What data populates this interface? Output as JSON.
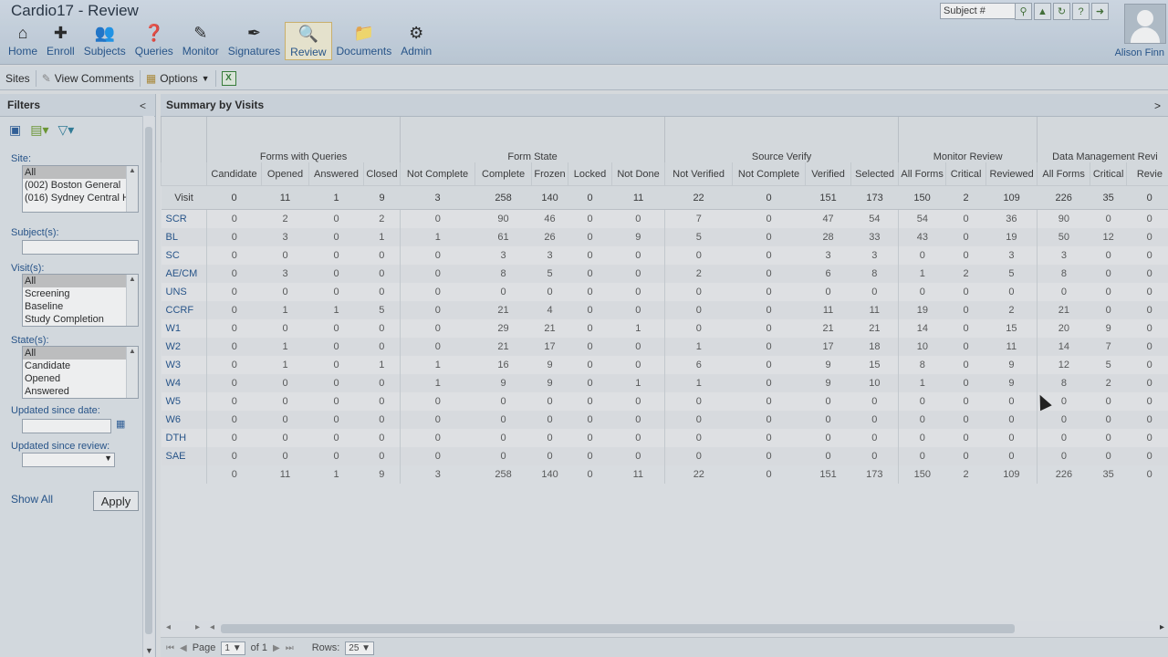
{
  "app": {
    "title": "Cardio17 - Review",
    "user": "Alison Finn"
  },
  "nav": [
    {
      "label": "Home",
      "icon": "home-icon",
      "glyph": "⌂",
      "active": false
    },
    {
      "label": "Enroll",
      "icon": "enroll-icon",
      "glyph": "✚",
      "active": false
    },
    {
      "label": "Subjects",
      "icon": "subjects-icon",
      "glyph": "👥",
      "active": false
    },
    {
      "label": "Queries",
      "icon": "queries-icon",
      "glyph": "❓",
      "active": false
    },
    {
      "label": "Monitor",
      "icon": "monitor-icon",
      "glyph": "✎",
      "active": false
    },
    {
      "label": "Signatures",
      "icon": "signatures-icon",
      "glyph": "✒",
      "active": false
    },
    {
      "label": "Review",
      "icon": "review-icon",
      "glyph": "🔍",
      "active": true
    },
    {
      "label": "Documents",
      "icon": "documents-icon",
      "glyph": "📁",
      "active": false
    },
    {
      "label": "Admin",
      "icon": "admin-icon",
      "glyph": "⚙",
      "active": false
    }
  ],
  "header": {
    "subject_placeholder": "Subject #"
  },
  "toolbar": {
    "sites": "Sites",
    "view_comments": "View Comments",
    "options": "Options"
  },
  "filters": {
    "title": "Filters",
    "site_label": "Site:",
    "sites": [
      "All",
      "(002) Boston General",
      "(016) Sydney Central H"
    ],
    "subject_label": "Subject(s):",
    "visit_label": "Visit(s):",
    "visits": [
      "All",
      "Screening",
      "Baseline",
      "Study Completion"
    ],
    "state_label": "State(s):",
    "states": [
      "All",
      "Candidate",
      "Opened",
      "Answered"
    ],
    "updated_date_label": "Updated since date:",
    "updated_review_label": "Updated since review:",
    "show_all": "Show All",
    "apply": "Apply"
  },
  "main": {
    "title": "Summary by Visits"
  },
  "table": {
    "groups": [
      "",
      "Forms with Queries",
      "Form State",
      "Source Verify",
      "Monitor Review",
      "Data Management Revi"
    ],
    "columns": [
      "Visit",
      "Candidate",
      "Opened",
      "Answered",
      "Closed",
      "Not Complete",
      "Complete",
      "Frozen",
      "Locked",
      "Not Done",
      "Not Verified",
      "Not Complete",
      "Verified",
      "Selected",
      "All Forms",
      "Critical",
      "Reviewed",
      "All Forms",
      "Critical",
      "Revie"
    ],
    "summary": [
      "Visit",
      "0",
      "11",
      "1",
      "9",
      "3",
      "258",
      "140",
      "0",
      "11",
      "22",
      "0",
      "151",
      "173",
      "150",
      "2",
      "109",
      "226",
      "35",
      "0"
    ],
    "rows": [
      [
        "SCR",
        "0",
        "2",
        "0",
        "2",
        "0",
        "90",
        "46",
        "0",
        "0",
        "7",
        "0",
        "47",
        "54",
        "54",
        "0",
        "36",
        "90",
        "0",
        "0"
      ],
      [
        "BL",
        "0",
        "3",
        "0",
        "1",
        "1",
        "61",
        "26",
        "0",
        "9",
        "5",
        "0",
        "28",
        "33",
        "43",
        "0",
        "19",
        "50",
        "12",
        "0"
      ],
      [
        "SC",
        "0",
        "0",
        "0",
        "0",
        "0",
        "3",
        "3",
        "0",
        "0",
        "0",
        "0",
        "3",
        "3",
        "0",
        "0",
        "3",
        "3",
        "0",
        "0"
      ],
      [
        "AE/CM",
        "0",
        "3",
        "0",
        "0",
        "0",
        "8",
        "5",
        "0",
        "0",
        "2",
        "0",
        "6",
        "8",
        "1",
        "2",
        "5",
        "8",
        "0",
        "0"
      ],
      [
        "UNS",
        "0",
        "0",
        "0",
        "0",
        "0",
        "0",
        "0",
        "0",
        "0",
        "0",
        "0",
        "0",
        "0",
        "0",
        "0",
        "0",
        "0",
        "0",
        "0"
      ],
      [
        "CCRF",
        "0",
        "1",
        "1",
        "5",
        "0",
        "21",
        "4",
        "0",
        "0",
        "0",
        "0",
        "11",
        "11",
        "19",
        "0",
        "2",
        "21",
        "0",
        "0"
      ],
      [
        "W1",
        "0",
        "0",
        "0",
        "0",
        "0",
        "29",
        "21",
        "0",
        "1",
        "0",
        "0",
        "21",
        "21",
        "14",
        "0",
        "15",
        "20",
        "9",
        "0"
      ],
      [
        "W2",
        "0",
        "1",
        "0",
        "0",
        "0",
        "21",
        "17",
        "0",
        "0",
        "1",
        "0",
        "17",
        "18",
        "10",
        "0",
        "11",
        "14",
        "7",
        "0"
      ],
      [
        "W3",
        "0",
        "1",
        "0",
        "1",
        "1",
        "16",
        "9",
        "0",
        "0",
        "6",
        "0",
        "9",
        "15",
        "8",
        "0",
        "9",
        "12",
        "5",
        "0"
      ],
      [
        "W4",
        "0",
        "0",
        "0",
        "0",
        "1",
        "9",
        "9",
        "0",
        "1",
        "1",
        "0",
        "9",
        "10",
        "1",
        "0",
        "9",
        "8",
        "2",
        "0"
      ],
      [
        "W5",
        "0",
        "0",
        "0",
        "0",
        "0",
        "0",
        "0",
        "0",
        "0",
        "0",
        "0",
        "0",
        "0",
        "0",
        "0",
        "0",
        "0",
        "0",
        "0"
      ],
      [
        "W6",
        "0",
        "0",
        "0",
        "0",
        "0",
        "0",
        "0",
        "0",
        "0",
        "0",
        "0",
        "0",
        "0",
        "0",
        "0",
        "0",
        "0",
        "0",
        "0"
      ],
      [
        "DTH",
        "0",
        "0",
        "0",
        "0",
        "0",
        "0",
        "0",
        "0",
        "0",
        "0",
        "0",
        "0",
        "0",
        "0",
        "0",
        "0",
        "0",
        "0",
        "0"
      ],
      [
        "SAE",
        "0",
        "0",
        "0",
        "0",
        "0",
        "0",
        "0",
        "0",
        "0",
        "0",
        "0",
        "0",
        "0",
        "0",
        "0",
        "0",
        "0",
        "0",
        "0"
      ]
    ],
    "totals": [
      "",
      "0",
      "11",
      "1",
      "9",
      "3",
      "258",
      "140",
      "0",
      "11",
      "22",
      "0",
      "151",
      "173",
      "150",
      "2",
      "109",
      "226",
      "35",
      "0"
    ]
  },
  "pager": {
    "page_label": "Page",
    "page_value": "1",
    "of_label": "of 1",
    "rows_label": "Rows:",
    "rows_value": "25"
  }
}
